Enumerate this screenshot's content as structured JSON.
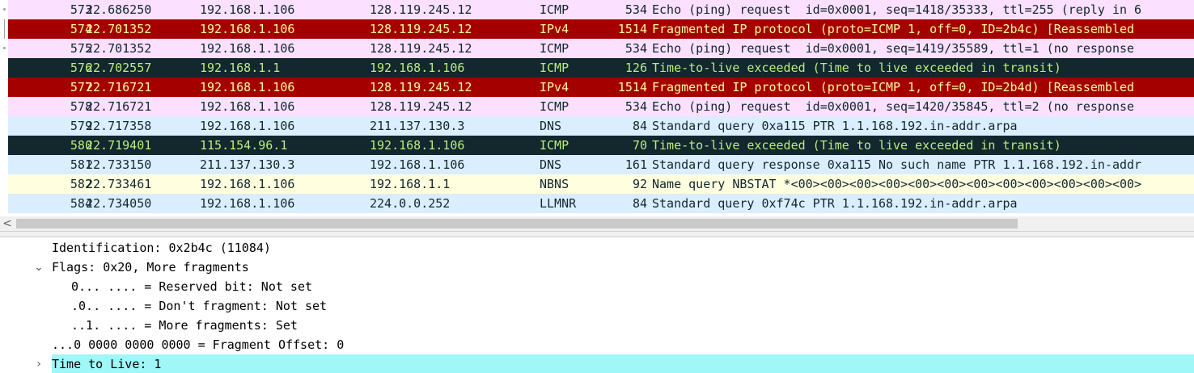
{
  "packets": [
    {
      "no": "573",
      "time": "22.686250",
      "src": "192.168.1.106",
      "dst": "128.119.245.12",
      "proto": "ICMP",
      "len": "534",
      "info": "Echo (ping) request  id=0x0001, seq=1418/35333, ttl=255 (reply in 6",
      "style": "icmp"
    },
    {
      "no": "574",
      "time": "22.701352",
      "src": "192.168.1.106",
      "dst": "128.119.245.12",
      "proto": "IPv4",
      "len": "1514",
      "info": "Fragmented IP protocol (proto=ICMP 1, off=0, ID=2b4c) [Reassembled",
      "style": "frag"
    },
    {
      "no": "575",
      "time": "22.701352",
      "src": "192.168.1.106",
      "dst": "128.119.245.12",
      "proto": "ICMP",
      "len": "534",
      "info": "Echo (ping) request  id=0x0001, seq=1419/35589, ttl=1 (no response",
      "style": "icmp"
    },
    {
      "no": "576",
      "time": "22.702557",
      "src": "192.168.1.1",
      "dst": "192.168.1.106",
      "proto": "ICMP",
      "len": "126",
      "info": "Time-to-live exceeded (Time to live exceeded in transit)",
      "style": "ttl"
    },
    {
      "no": "577",
      "time": "22.716721",
      "src": "192.168.1.106",
      "dst": "128.119.245.12",
      "proto": "IPv4",
      "len": "1514",
      "info": "Fragmented IP protocol (proto=ICMP 1, off=0, ID=2b4d) [Reassembled",
      "style": "frag"
    },
    {
      "no": "578",
      "time": "22.716721",
      "src": "192.168.1.106",
      "dst": "128.119.245.12",
      "proto": "ICMP",
      "len": "534",
      "info": "Echo (ping) request  id=0x0001, seq=1420/35845, ttl=2 (no response",
      "style": "icmp"
    },
    {
      "no": "579",
      "time": "22.717358",
      "src": "192.168.1.106",
      "dst": "211.137.130.3",
      "proto": "DNS",
      "len": "84",
      "info": "Standard query 0xa115 PTR 1.1.168.192.in-addr.arpa",
      "style": "udp"
    },
    {
      "no": "580",
      "time": "22.719401",
      "src": "115.154.96.1",
      "dst": "192.168.1.106",
      "proto": "ICMP",
      "len": "70",
      "info": "Time-to-live exceeded (Time to live exceeded in transit)",
      "style": "ttl"
    },
    {
      "no": "581",
      "time": "22.733150",
      "src": "211.137.130.3",
      "dst": "192.168.1.106",
      "proto": "DNS",
      "len": "161",
      "info": "Standard query response 0xa115 No such name PTR 1.1.168.192.in-addr",
      "style": "udp"
    },
    {
      "no": "582",
      "time": "22.733461",
      "src": "192.168.1.106",
      "dst": "192.168.1.1",
      "proto": "NBNS",
      "len": "92",
      "info": "Name query NBSTAT *<00><00><00><00><00><00><00><00><00><00><00><00>",
      "style": "nbns"
    },
    {
      "no": "584",
      "time": "22.734050",
      "src": "192.168.1.106",
      "dst": "224.0.0.252",
      "proto": "LLMNR",
      "len": "84",
      "info": "Standard query 0xf74c PTR 1.1.168.192.in-addr.arpa",
      "style": "udp"
    }
  ],
  "row_markers": [
    "dot",
    "vline",
    "dot",
    "",
    "",
    "",
    "",
    "",
    "",
    "",
    ""
  ],
  "scrollbar": {
    "left_arrow_icon": "chevron-left-icon",
    "left_arrow_glyph": "<"
  },
  "details": [
    {
      "indent": 64,
      "toggle": "",
      "text": "Identification: 0x2b4c (11084)",
      "highlight": false
    },
    {
      "indent": 64,
      "toggle": "expanded",
      "text": "Flags: 0x20, More fragments",
      "highlight": false
    },
    {
      "indent": 88,
      "toggle": "",
      "text": "0... .... = Reserved bit: Not set",
      "highlight": false
    },
    {
      "indent": 88,
      "toggle": "",
      "text": ".0.. .... = Don't fragment: Not set",
      "highlight": false
    },
    {
      "indent": 88,
      "toggle": "",
      "text": "..1. .... = More fragments: Set",
      "highlight": false
    },
    {
      "indent": 64,
      "toggle": "",
      "text": "...0 0000 0000 0000 = Fragment Offset: 0",
      "highlight": false
    },
    {
      "indent": 64,
      "toggle": "collapsed",
      "text": "Time to Live: 1",
      "highlight": true
    }
  ],
  "toggle_glyphs": {
    "expanded": "⌄",
    "collapsed": "›"
  },
  "colors": {
    "icmp_bg": "#fce0ff",
    "frag_bg": "#a40000",
    "frag_fg": "#fffc9c",
    "ttl_bg": "#12272e",
    "ttl_fg": "#b8ef7c",
    "udp_bg": "#daeeff",
    "nbns_bg": "#ffffe0",
    "highlight_bg": "#a0f7f7"
  }
}
